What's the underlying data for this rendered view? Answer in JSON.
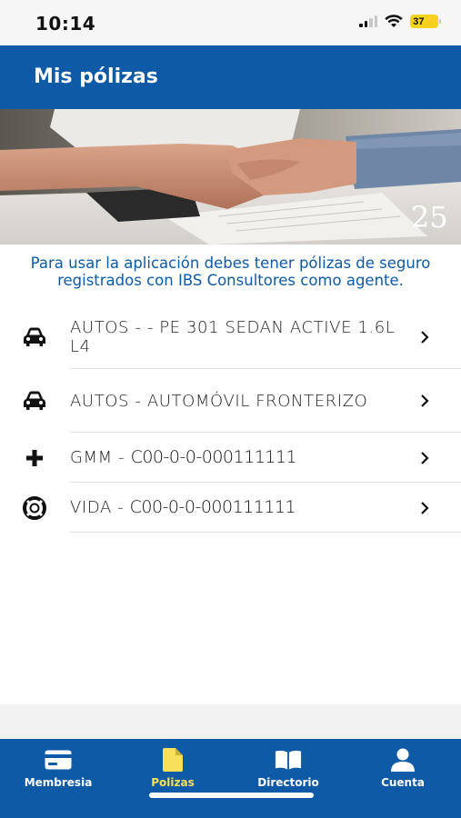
{
  "status_bar": {
    "time": "10:14",
    "battery": "37"
  },
  "header": {
    "title": "Mis pólizas"
  },
  "hero": {
    "icon": "handshake-photo",
    "watermark_number": "25"
  },
  "info": {
    "message": "Para usar la aplicación debes tener pólizas de seguro registrados con IBS Consultores como agente."
  },
  "policies": [
    {
      "icon": "car-icon",
      "label": "AUTOS - - PE 301 SEDAN ACTIVE 1.6L L4",
      "code": ""
    },
    {
      "icon": "car-icon",
      "label": "AUTOS - AUTOMÓVIL FRONTERIZO",
      "code": ""
    },
    {
      "icon": "plus-icon",
      "label": "GMM - ",
      "code": "C00-0-0-000111111"
    },
    {
      "icon": "lifebuoy-icon",
      "label": "VIDA - ",
      "code": "C00-0-0-000111111"
    }
  ],
  "bottom_nav": {
    "items": [
      {
        "label": "Membresia",
        "icon": "card-icon",
        "active": false
      },
      {
        "label": "Polizas",
        "icon": "document-icon",
        "active": true
      },
      {
        "label": "Directorio",
        "icon": "book-icon",
        "active": false
      },
      {
        "label": "Cuenta",
        "icon": "user-icon",
        "active": false
      }
    ]
  },
  "colors": {
    "primary": "#0e5aa7",
    "active_nav": "#f6e05a",
    "battery": "#f5d31c"
  }
}
